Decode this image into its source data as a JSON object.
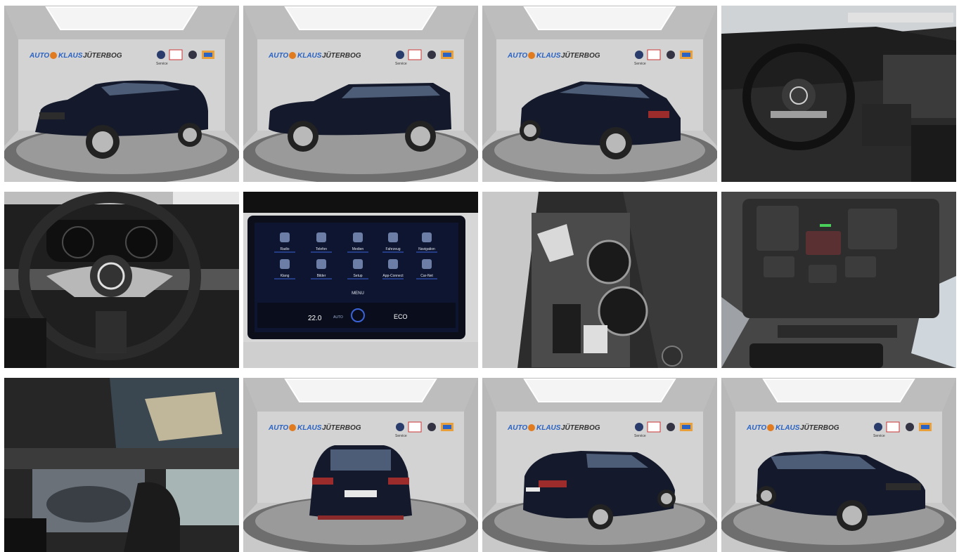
{
  "gallery": {
    "showroom_sign": {
      "part1": "AUTO",
      "part2": "KLAUS",
      "part3": "JÜTERBOG",
      "badge_text": "Service"
    },
    "dashboard_screen": {
      "apps_row1": [
        "Radio",
        "Telefon",
        "Medien",
        "Fahrzeug",
        "Navigation"
      ],
      "apps_row2": [
        "Klang",
        "Bilder",
        "Setup",
        "App-Connect",
        "Car-Net"
      ],
      "menu_label": "MENU",
      "temperature": "22.0",
      "auto_label": "AUTO",
      "eco_label": "ECO"
    },
    "colors": {
      "car_body": "#141a2b",
      "showroom_wall": "#cfcfcf",
      "turntable": "#8e8e8e",
      "interior": "#1c1c1c",
      "sign_blue": "#2a63c4"
    },
    "photos": [
      {
        "name": "photo-front-left",
        "view": "exterior-front-left"
      },
      {
        "name": "photo-side-left",
        "view": "exterior-side-left"
      },
      {
        "name": "photo-rear-left",
        "view": "exterior-rear-left"
      },
      {
        "name": "photo-cockpit",
        "view": "interior-cockpit"
      },
      {
        "name": "photo-steering-wheel",
        "view": "interior-steering-wheel"
      },
      {
        "name": "photo-infotainment",
        "view": "interior-infotainment"
      },
      {
        "name": "photo-center-console",
        "view": "interior-center-console"
      },
      {
        "name": "photo-overhead-console",
        "view": "interior-overhead-console"
      },
      {
        "name": "photo-panoramic-roof",
        "view": "interior-panoramic-roof"
      },
      {
        "name": "photo-rear",
        "view": "exterior-rear"
      },
      {
        "name": "photo-rear-right",
        "view": "exterior-rear-right"
      },
      {
        "name": "photo-front-right",
        "view": "exterior-front-right"
      }
    ]
  }
}
